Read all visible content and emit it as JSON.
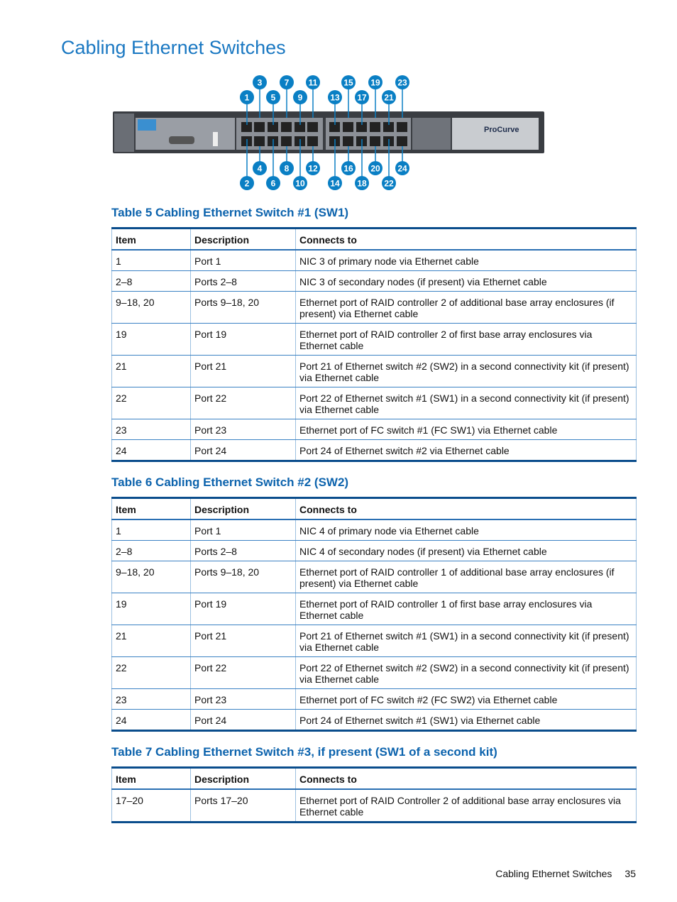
{
  "page_title": "Cabling Ethernet Switches",
  "figure": {
    "brand": "ProCurve",
    "callouts_top": [
      "3",
      "7",
      "11",
      "15",
      "19",
      "23"
    ],
    "callouts_upper": [
      "1",
      "5",
      "9",
      "13",
      "17",
      "21"
    ],
    "callouts_lower": [
      "4",
      "8",
      "12",
      "16",
      "20",
      "24"
    ],
    "callouts_bottom": [
      "2",
      "6",
      "10",
      "14",
      "18",
      "22"
    ],
    "colors": {
      "callout": "#0a7fc4",
      "body": "#3a3d42"
    }
  },
  "tables": [
    {
      "caption": "Table 5 Cabling Ethernet Switch #1 (SW1)",
      "headers": [
        "Item",
        "Description",
        "Connects to"
      ],
      "rows": [
        [
          "1",
          "Port 1",
          "NIC 3 of primary node via Ethernet cable"
        ],
        [
          "2–8",
          "Ports 2–8",
          "NIC 3 of secondary nodes (if present) via Ethernet cable"
        ],
        [
          "9–18, 20",
          "Ports 9–18, 20",
          "Ethernet port of RAID controller 2 of additional base array enclosures (if present) via Ethernet cable"
        ],
        [
          "19",
          "Port 19",
          "Ethernet port of RAID controller 2 of first base array enclosures via Ethernet cable"
        ],
        [
          "21",
          "Port 21",
          "Port 21 of Ethernet switch #2 (SW2) in a second connectivity kit (if present) via Ethernet cable"
        ],
        [
          "22",
          "Port 22",
          "Port 22 of Ethernet switch #1 (SW1) in a second connectivity kit (if present) via Ethernet cable"
        ],
        [
          "23",
          "Port 23",
          "Ethernet port of FC switch #1 (FC SW1) via Ethernet cable"
        ],
        [
          "24",
          "Port 24",
          "Port 24 of Ethernet switch #2 via Ethernet cable"
        ]
      ]
    },
    {
      "caption": "Table 6 Cabling Ethernet Switch #2 (SW2)",
      "headers": [
        "Item",
        "Description",
        "Connects to"
      ],
      "rows": [
        [
          "1",
          "Port 1",
          "NIC 4 of primary node via Ethernet cable"
        ],
        [
          "2–8",
          "Ports 2–8",
          "NIC 4 of secondary nodes (if present) via Ethernet cable"
        ],
        [
          "9–18, 20",
          "Ports 9–18, 20",
          "Ethernet port of RAID controller 1 of additional base array enclosures (if present) via Ethernet cable"
        ],
        [
          "19",
          "Port 19",
          "Ethernet port of RAID controller 1 of first base array enclosures via Ethernet cable"
        ],
        [
          "21",
          "Port 21",
          "Port 21 of Ethernet switch #1 (SW1) in a second connectivity kit (if present) via Ethernet cable"
        ],
        [
          "22",
          "Port 22",
          "Port 22 of Ethernet switch #2 (SW2) in a second connectivity kit (if present) via Ethernet cable"
        ],
        [
          "23",
          "Port 23",
          "Ethernet port of FC switch #2 (FC SW2) via Ethernet cable"
        ],
        [
          "24",
          "Port 24",
          "Port 24 of Ethernet switch #1 (SW1) via Ethernet cable"
        ]
      ]
    },
    {
      "caption": "Table 7 Cabling Ethernet Switch #3, if present (SW1 of a second kit)",
      "headers": [
        "Item",
        "Description",
        "Connects to"
      ],
      "rows": [
        [
          "17–20",
          "Ports 17–20",
          "Ethernet port of RAID Controller 2 of additional base array enclosures via Ethernet cable"
        ]
      ]
    }
  ],
  "footer": {
    "section": "Cabling Ethernet Switches",
    "page": "35"
  }
}
